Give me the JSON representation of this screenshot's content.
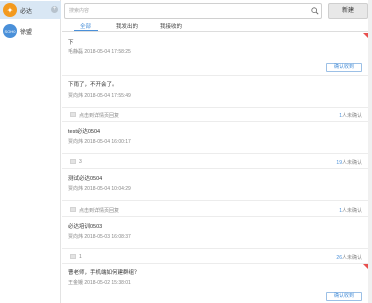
{
  "sidebar": {
    "items": [
      {
        "name": "必达",
        "avatar_text": "✦",
        "active": true,
        "has_add": true,
        "add_label": "+"
      },
      {
        "name": "徐盟",
        "avatar_text": "SOH0",
        "active": false
      }
    ]
  },
  "toolbar": {
    "search_placeholder": "搜索内容",
    "new_label": "新建"
  },
  "tabs": [
    {
      "label": "全部",
      "active": true
    },
    {
      "label": "我发出的",
      "active": false
    },
    {
      "label": "我接收的",
      "active": false
    }
  ],
  "messages": [
    {
      "title": "下",
      "author": "毛静磊",
      "time": "2018-05-04 17:58:25",
      "confirm_label": "确认收到"
    },
    {
      "title": "下雨了，不开会了。",
      "author": "贾向炜",
      "time": "2018-05-04 17:55:49",
      "action_label": "点击到详情页回复",
      "unconfirmed_count": "1",
      "unconfirmed_suffix": "人未确认"
    },
    {
      "title": "test必达0504",
      "author": "贾向炜",
      "time": "2018-05-04 16:00:17",
      "action_label": "3",
      "unconfirmed_count": "19",
      "unconfirmed_suffix": "人未确认"
    },
    {
      "title": "测试必达0504",
      "author": "贾向炜",
      "time": "2018-05-04 10:04:29",
      "action_label": "点击到详情页回复",
      "unconfirmed_count": "1",
      "unconfirmed_suffix": "人未确认"
    },
    {
      "title": "必达培训0503",
      "author": "贾向炜",
      "time": "2018-05-03 16:08:37",
      "action_label": "1",
      "unconfirmed_count": "26",
      "unconfirmed_suffix": "人未确认"
    },
    {
      "title": "曹老师，手机端如何建群组？",
      "author": "王金娥",
      "time": "2018-05-02 15:38:01",
      "confirm_label": "确认收到"
    }
  ],
  "colors": {
    "accent": "#4a90d9",
    "sidebar_active_bg": "#d9e7f4",
    "unread_marker": "#e8504f",
    "avatar_orange": "#f39a1f"
  }
}
